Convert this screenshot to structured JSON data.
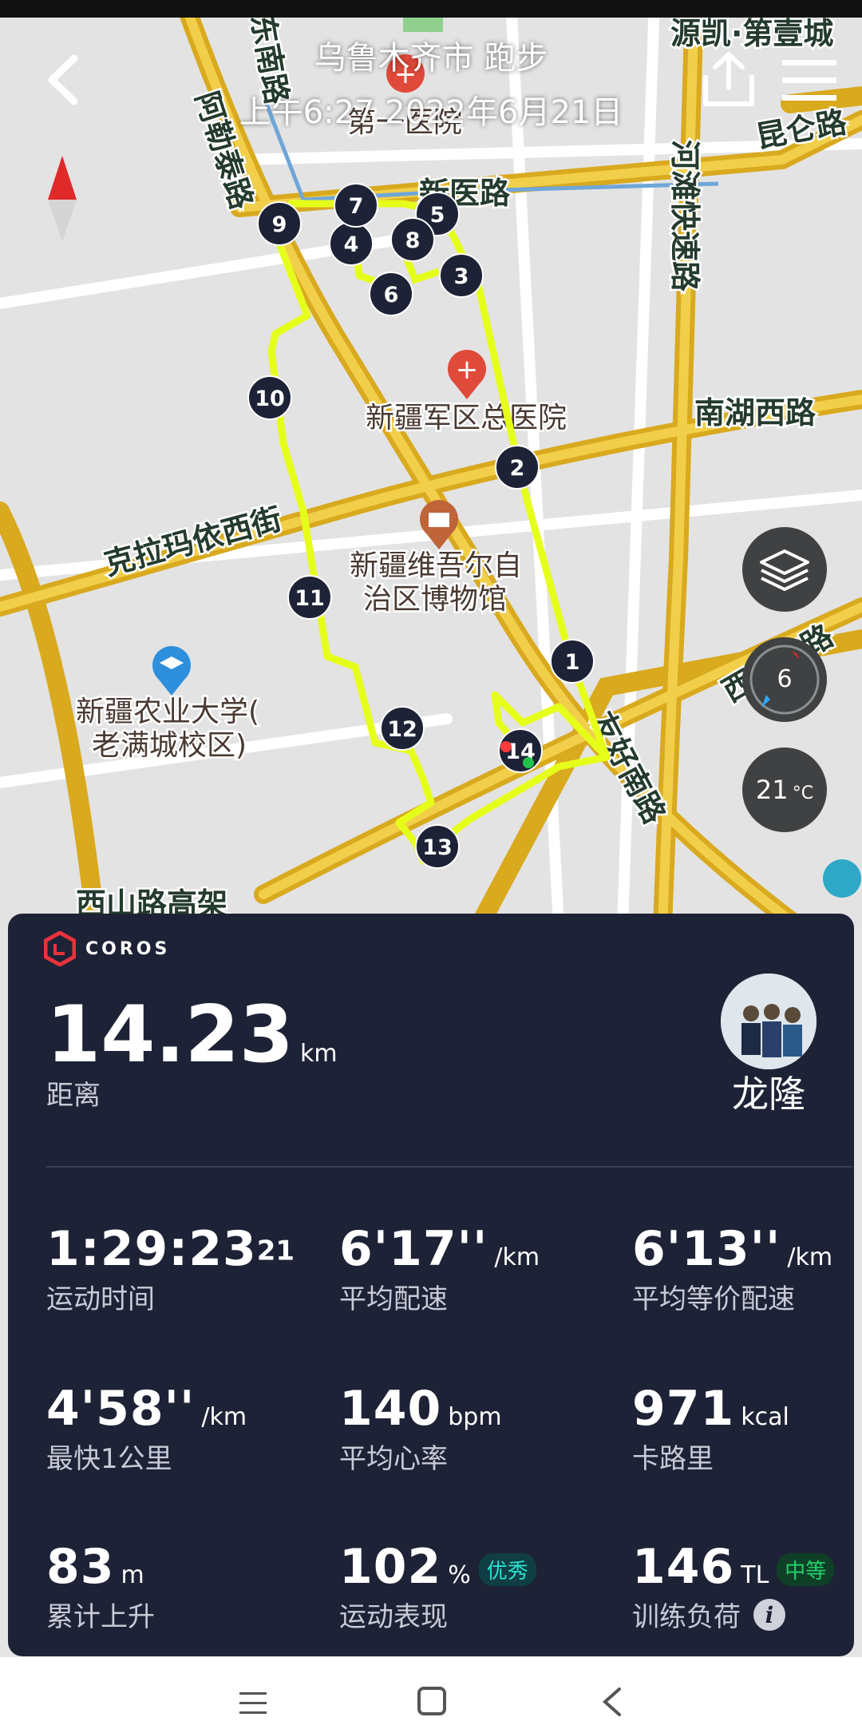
{
  "header": {
    "title": "乌鲁木齐市 跑步",
    "subtitle": "上午6:27 2022年6月21日"
  },
  "map": {
    "road_labels": [
      "阿勒泰路",
      "东南路",
      "新医路",
      "河滩快速路",
      "昆仑路",
      "南湖西路",
      "克拉玛依西街",
      "友好南路",
      "西虹东路",
      "西山路高架",
      "源凯·第壹城"
    ],
    "poi_labels": [
      "第一医院",
      "新疆军区总医院",
      "新疆维吾尔自治区博物馆",
      "新疆农业大学(老满城校区)"
    ],
    "km_markers": [
      "1",
      "2",
      "3",
      "4",
      "5",
      "6",
      "7",
      "8",
      "9",
      "10",
      "11",
      "12",
      "13",
      "14"
    ],
    "compass_value": "6",
    "temperature": "21",
    "temperature_unit": "°C"
  },
  "panel": {
    "brand": "COROS",
    "distance_value": "14.23",
    "distance_unit": "km",
    "distance_label": "距离",
    "user_name": "龙隆",
    "stats": {
      "time_value": "1:29:23",
      "time_hundredths": "21",
      "time_label": "运动时间",
      "pace_value": "6'17''",
      "pace_unit": "/km",
      "pace_label": "平均配速",
      "eq_pace_value": "6'13''",
      "eq_pace_unit": "/km",
      "eq_pace_label": "平均等价配速",
      "fast_km_value": "4'58''",
      "fast_km_unit": "/km",
      "fast_km_label": "最快1公里",
      "hr_value": "140",
      "hr_unit": "bpm",
      "hr_label": "平均心率",
      "cal_value": "971",
      "cal_unit": "kcal",
      "cal_label": "卡路里",
      "elev_value": "83",
      "elev_unit": "m",
      "elev_label": "累计上升",
      "perf_value": "102",
      "perf_unit": "%",
      "perf_badge": "优秀",
      "perf_label": "运动表现",
      "load_value": "146",
      "load_unit": "TL",
      "load_badge": "中等",
      "load_label": "训练负荷"
    }
  },
  "colors": {
    "route": "#e6ff1a",
    "road": "#e0b52a",
    "panel_bg": "#1e2236",
    "badge_excellent": "#2ee0cf",
    "badge_medium": "#23d16a"
  }
}
